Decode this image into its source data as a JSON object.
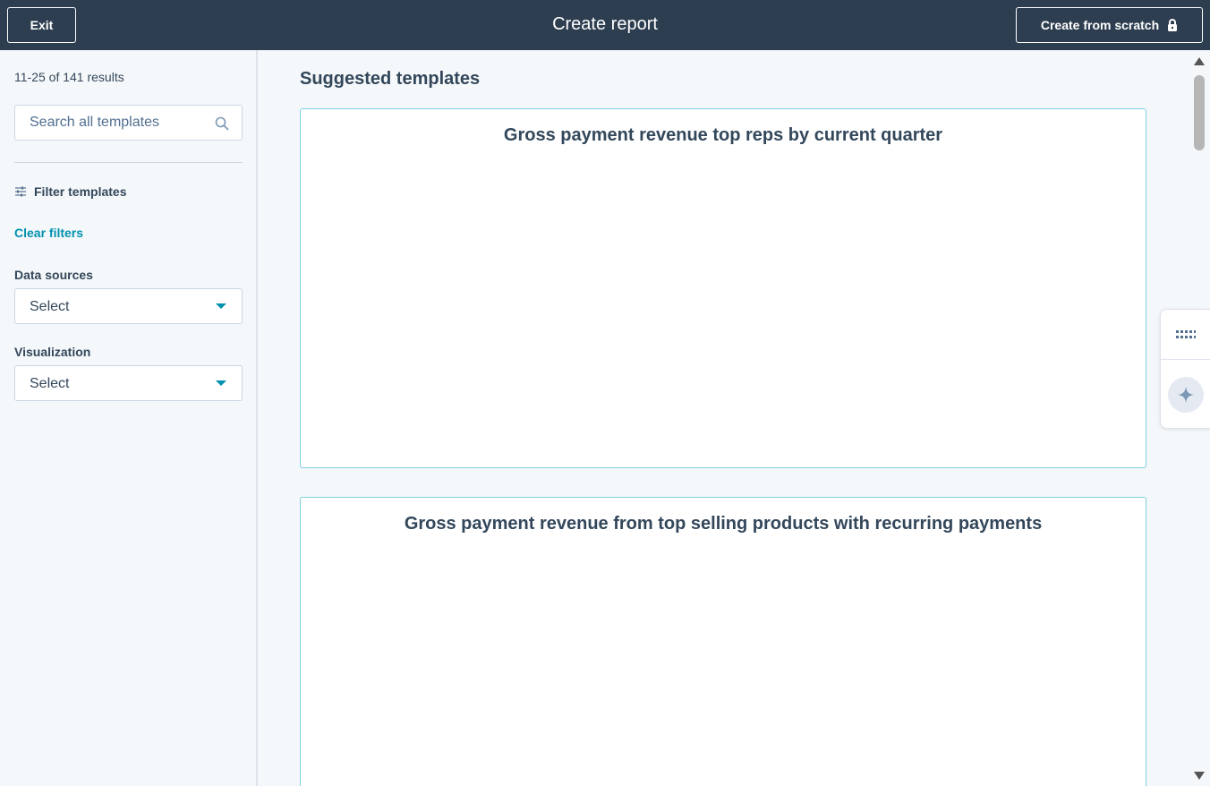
{
  "header": {
    "exit_label": "Exit",
    "title": "Create report",
    "create_scratch_label": "Create from scratch"
  },
  "sidebar": {
    "results_count": "11-25 of 141 results",
    "search_placeholder": "Search all templates",
    "filter_heading": "Filter templates",
    "clear_filters_label": "Clear filters",
    "data_sources": {
      "label": "Data sources",
      "value": "Select"
    },
    "visualization": {
      "label": "Visualization",
      "value": "Select"
    }
  },
  "main": {
    "section_title": "Suggested templates",
    "cards": [
      {
        "title": "Gross payment revenue top reps by current quarter"
      },
      {
        "title": "Gross payment revenue from top selling products with recurring payments"
      }
    ]
  },
  "icons": {
    "lock": "lock-icon",
    "search": "search-icon",
    "filter": "sliders-icon",
    "caret": "chevron-down-icon",
    "grip": "grip-dots-icon",
    "ai": "sparkle-icon"
  },
  "colors": {
    "header_bg": "#2d3e50",
    "accent": "#0091ae",
    "text": "#33475b",
    "card_border": "#7fd1de",
    "page_bg": "#f5f8fa"
  }
}
